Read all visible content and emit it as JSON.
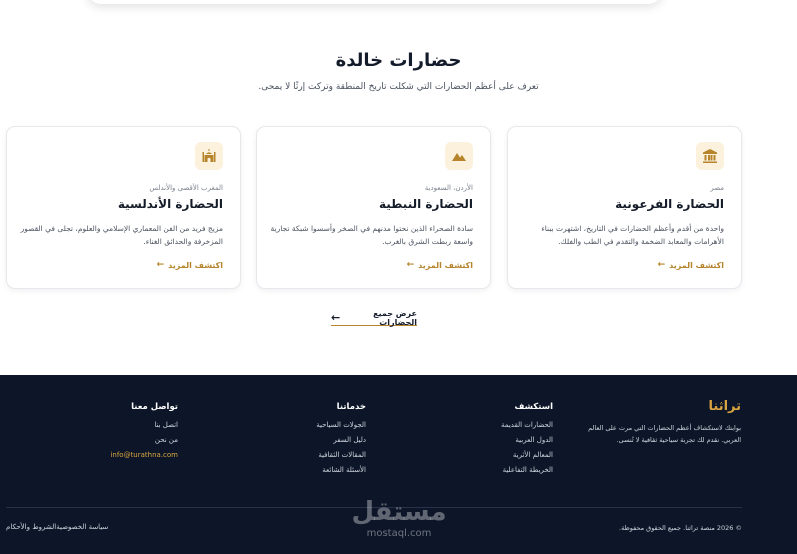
{
  "section": {
    "title": "حضارات خالدة",
    "subtitle": "تعرف على أعظم الحضارات التي شكلت تاريخ المنطقة وتركت إرثًا لا يمحى."
  },
  "cards": [
    {
      "icon": "museum-icon",
      "region": "مصر",
      "title": "الحضارة الفرعونية",
      "desc": "واحدة من أقدم وأعظم الحضارات في التاريخ، اشتهرت ببناء الأهرامات والمعابد الضخمة والتقدم في الطب والفلك.",
      "link": "اكتشف المزيد"
    },
    {
      "icon": "mountain-icon",
      "region": "الأردن، السعودية",
      "title": "الحضارة النبطية",
      "desc": "سادة الصحراء الذين نحتوا مدنهم في الصخر وأسسوا شبكة تجارية واسعة ربطت الشرق بالغرب.",
      "link": "اكتشف المزيد"
    },
    {
      "icon": "mosque-icon",
      "region": "المغرب الأقصى والأندلس",
      "title": "الحضارة الأندلسية",
      "desc": "مزيج فريد من الفن المعماري الإسلامي والعلوم، تجلى في القصور المزخرفة والحدائق الغناء.",
      "link": "اكتشف المزيد"
    }
  ],
  "view_all": "عرض جميع الحضارات",
  "footer": {
    "brand": {
      "name": "تراثنا",
      "desc": "بوابتك لاستكشاف أعظم الحضارات التي مرت على العالم العربي. نقدم لك تجربة سياحية ثقافية لا تُنسى."
    },
    "explore": {
      "title": "استكشف",
      "items": [
        "الحضارات القديمة",
        "الدول العربية",
        "المعالم الأثرية",
        "الخريطة التفاعلية"
      ]
    },
    "services": {
      "title": "خدماتنا",
      "items": [
        "الجولات السياحية",
        "دليل السفر",
        "المقالات الثقافية",
        "الأسئلة الشائعة"
      ]
    },
    "contact": {
      "title": "تواصل معنا",
      "items": [
        "اتصل بنا",
        "من نحن"
      ],
      "email": "info@turathna.com"
    },
    "copyright": "© 2026 منصة تراثنا. جميع الحقوق محفوظة.",
    "legal": {
      "privacy": "سياسة الخصوصية",
      "terms": "الشروط والأحكام"
    },
    "watermark": {
      "ar": "مستقل",
      "en": "mostaql.com"
    }
  },
  "colors": {
    "accent": "#b5842b",
    "brand_gold": "#d9a441",
    "footer_bg": "#0c1628",
    "icon_bg": "#fbf1dc"
  }
}
